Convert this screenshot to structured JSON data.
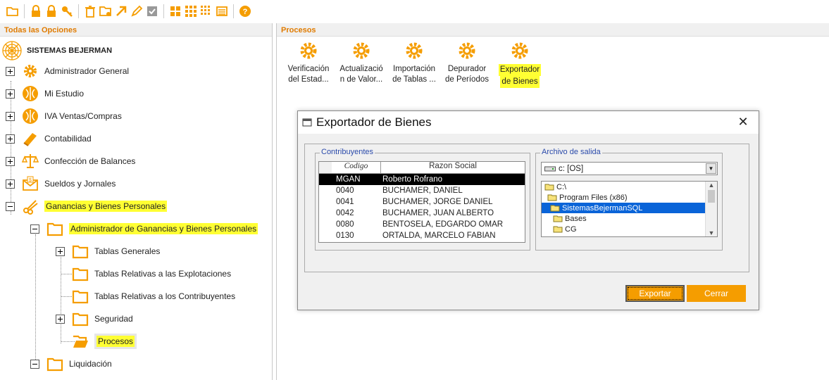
{
  "toolbar": {
    "icons": [
      "folder-open-icon",
      "lock-icon",
      "lock-icon",
      "key-icon",
      "trash-icon",
      "folder-settings-icon",
      "export-arrow-icon",
      "edit-pencil-icon",
      "checkbox-icon",
      "grid-large-icon",
      "grid-medium-icon",
      "grid-small-icon",
      "list-icon",
      "help-icon"
    ]
  },
  "left_panel": {
    "header": "Todas las Opciones",
    "root_label": "SISTEMAS BEJERMAN",
    "items": [
      {
        "label": "Administrador General"
      },
      {
        "label": "Mi Estudio"
      },
      {
        "label": "IVA Ventas/Compras"
      },
      {
        "label": "Contabilidad"
      },
      {
        "label": "Confección de Balances"
      },
      {
        "label": "Sueldos y Jornales"
      },
      {
        "label": "Ganancias y Bienes Personales"
      },
      {
        "label": "Administrador de Ganancias y Bienes Personales"
      },
      {
        "label": "Tablas Generales"
      },
      {
        "label": "Tablas Relativas a las Explotaciones"
      },
      {
        "label": "Tablas Relativas a los Contribuyentes"
      },
      {
        "label": "Seguridad"
      },
      {
        "label": "Procesos"
      },
      {
        "label": "Liquidación"
      }
    ]
  },
  "right_panel": {
    "header": "Procesos",
    "processes": [
      {
        "line1": "Verificación",
        "line2": "del Estad..."
      },
      {
        "line1": "Actualizació",
        "line2": "n de Valor..."
      },
      {
        "line1": "Importación",
        "line2": "de Tablas ..."
      },
      {
        "line1": "Depurador",
        "line2": "de Períodos"
      },
      {
        "line1": "Exportador",
        "line2": "de Bienes"
      }
    ]
  },
  "dialog": {
    "title": "Exportador de Bienes",
    "contrib_label": "Contribuyentes",
    "col_code": "Codigo",
    "col_name": "Razon Social",
    "rows": [
      {
        "code": "MGAN",
        "name": "Roberto Rofrano"
      },
      {
        "code": "0040",
        "name": "BUCHAMER, DANIEL"
      },
      {
        "code": "0041",
        "name": "BUCHAMER, JORGE DANIEL"
      },
      {
        "code": "0042",
        "name": "BUCHAMER, JUAN ALBERTO"
      },
      {
        "code": "0080",
        "name": "BENTOSELA, EDGARDO OMAR"
      },
      {
        "code": "0130",
        "name": "ORTALDA, MARCELO FABIAN"
      }
    ],
    "output_label": "Archivo de salida",
    "drive": "c: [OS]",
    "dirs": [
      "C:\\",
      "Program Files (x86)",
      "SistemasBejermanSQL",
      "Bases",
      "CG"
    ],
    "export_button": "Exportar",
    "close_button": "Cerrar"
  },
  "colors": {
    "accent": "#f59d00",
    "header_text": "#e07b00",
    "highlight": "#ffff33",
    "selection": "#0a64d8"
  }
}
